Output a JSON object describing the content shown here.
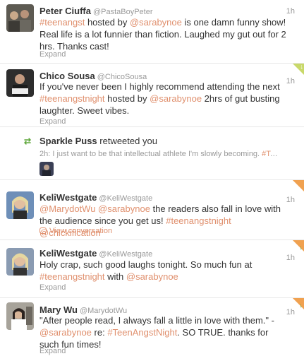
{
  "colors": {
    "link": "#e0906e",
    "meta": "#999999",
    "new_marker": "#c9d96a",
    "fav_marker": "#f0a150"
  },
  "tweets": [
    {
      "name": "Peter Ciuffa",
      "handle": "@PastaBoyPeter",
      "time": "1h",
      "segments": [
        {
          "t": "#teenangst",
          "k": "tag"
        },
        {
          "t": " hosted by ",
          "k": "text"
        },
        {
          "t": "@sarabynoe",
          "k": "mention"
        },
        {
          "t": " is one damn funny show! Real life is a lot funnier than fiction. Laughed my gut out for 2 hrs. Thanks cast!",
          "k": "text"
        }
      ],
      "action": "Expand",
      "avatar_icon": "group-photo"
    },
    {
      "name": "Chico Sousa",
      "handle": "@ChicoSousa",
      "time": "1h",
      "segments": [
        {
          "t": "If you've never been I highly recommend attending the next ",
          "k": "text"
        },
        {
          "t": "#teenangstnight",
          "k": "tag"
        },
        {
          "t": " hosted by ",
          "k": "text"
        },
        {
          "t": "@sarabynoe",
          "k": "mention"
        },
        {
          "t": " 2hrs of gut busting laughter. Sweet vibes.",
          "k": "text"
        }
      ],
      "action": "Expand",
      "avatar_icon": "person-photo"
    },
    {
      "name": "KeliWestgate",
      "handle": "@KeliWestgate",
      "time": "1h",
      "segments": [
        {
          "t": "@MarydotWu",
          "k": "mention"
        },
        {
          "t": " ",
          "k": "text"
        },
        {
          "t": "@sarabynoe",
          "k": "mention"
        },
        {
          "t": " the readers also fall in love with the audience since you get us! ",
          "k": "text"
        },
        {
          "t": "#teenangstnight",
          "k": "tag"
        },
        {
          "t": " ",
          "k": "text"
        },
        {
          "t": "@chickification",
          "k": "mention"
        }
      ],
      "action": "View conversation",
      "avatar_icon": "person-photo"
    },
    {
      "name": "KeliWestgate",
      "handle": "@KeliWestgate",
      "time": "1h",
      "segments": [
        {
          "t": "Holy crap, such good laughs tonight. So much fun at ",
          "k": "text"
        },
        {
          "t": "#teenangstnight",
          "k": "tag"
        },
        {
          "t": " with ",
          "k": "text"
        },
        {
          "t": "@sarabynoe",
          "k": "mention"
        }
      ],
      "action": "Expand",
      "avatar_icon": "person-photo"
    },
    {
      "name": "Mary Wu",
      "handle": "@MarydotWu",
      "time": "1h",
      "segments": [
        {
          "t": "\"After people read, I always fall a little in love with them.\" - ",
          "k": "text"
        },
        {
          "t": "@sarabynoe",
          "k": "mention"
        },
        {
          "t": " re: ",
          "k": "text"
        },
        {
          "t": "#TeenAngstNight",
          "k": "tag"
        },
        {
          "t": ". SO TRUE. thanks for such fun times!",
          "k": "text"
        }
      ],
      "action": "Expand",
      "avatar_icon": "person-photo"
    }
  ],
  "retweet": {
    "icon": "retweet-icon",
    "actor": "Sparkle Puss",
    "verb": " retweeted you",
    "time_prefix": "2h: ",
    "text": "I just want to be that intellectual athlete I'm slowly becoming. ",
    "tag": "#TeenA..."
  }
}
